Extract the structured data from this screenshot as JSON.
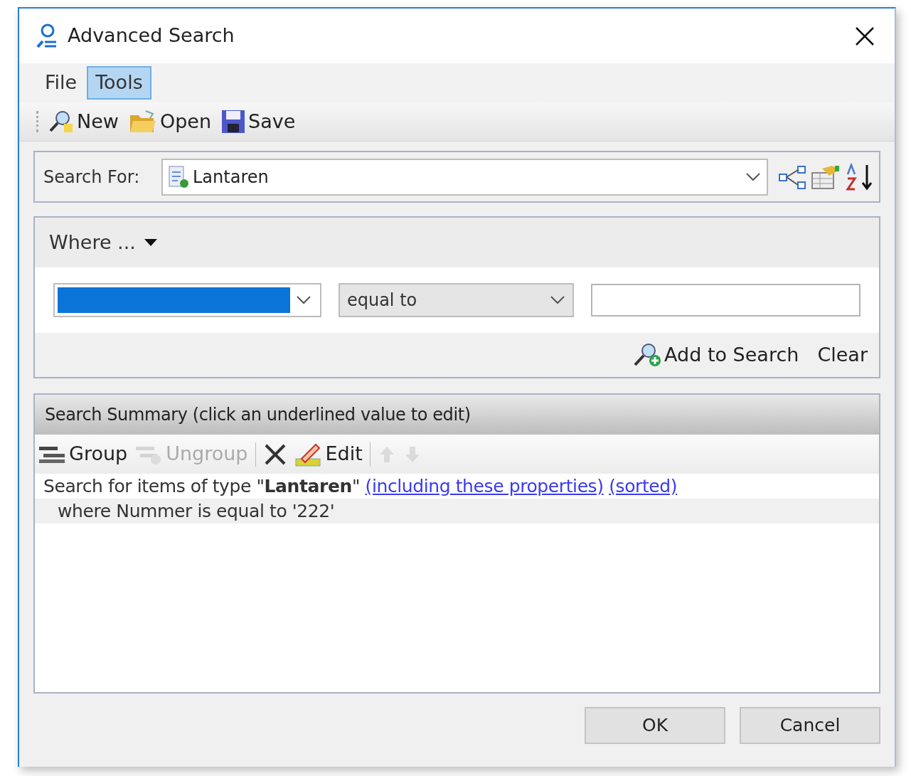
{
  "window": {
    "title": "Advanced Search"
  },
  "menu": [
    {
      "label": "File",
      "selected": false
    },
    {
      "label": "Tools",
      "selected": true
    }
  ],
  "toolbar": [
    {
      "label": "New",
      "kind": "new"
    },
    {
      "label": "Open",
      "kind": "open"
    },
    {
      "label": "Save",
      "kind": "save"
    }
  ],
  "search_for": {
    "label": "Search For:",
    "value": "Lantaren"
  },
  "where": {
    "label": "Where ...",
    "field_dropdown": {
      "selected": true
    },
    "operator": "equal to",
    "actions": [
      {
        "label": "Add to Search",
        "kind": "add"
      },
      {
        "label": "Clear",
        "kind": "plain"
      }
    ]
  },
  "summary": {
    "title": "Search Summary (click an underlined value to edit)",
    "tools": [
      {
        "kind": "group",
        "label": "Group",
        "disabled": false
      },
      {
        "kind": "ungroup",
        "label": "Ungroup",
        "disabled": true
      },
      {
        "kind": "delete",
        "disabled": false
      },
      {
        "kind": "edit",
        "label": "Edit",
        "disabled": false
      },
      {
        "kind": "up",
        "disabled": true
      },
      {
        "kind": "down",
        "disabled": true
      }
    ],
    "lines": [
      {
        "text": "Search for items of type \"**Lantaren**\"",
        "links": [
          "(including these properties)",
          "(sorted)"
        ]
      },
      {
        "text": "where Nummer is equal to '222'"
      }
    ]
  },
  "buttons": [
    "OK",
    "Cancel"
  ]
}
